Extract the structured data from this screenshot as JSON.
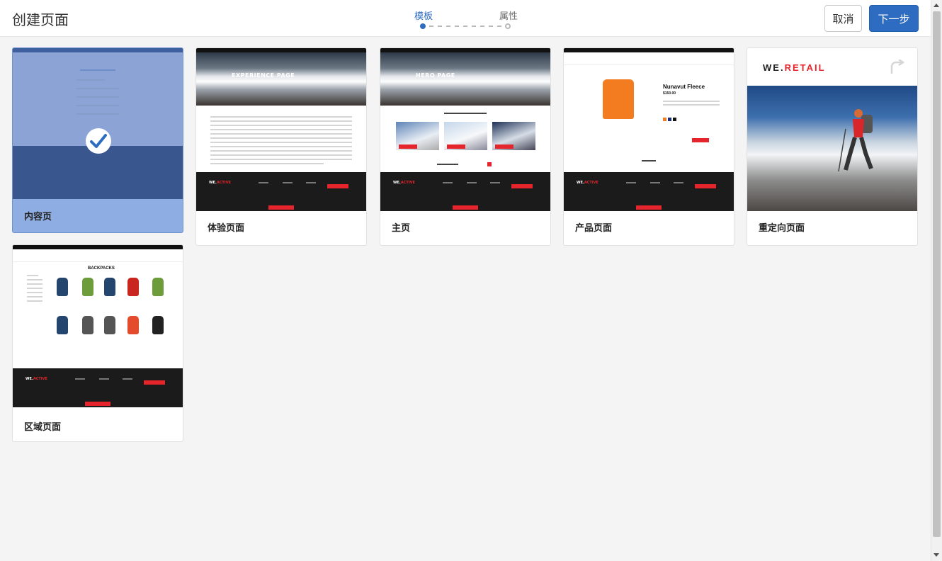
{
  "header": {
    "title": "创建页面",
    "steps": [
      {
        "label": "模板",
        "active": true
      },
      {
        "label": "属性",
        "active": false
      }
    ],
    "cancel_label": "取消",
    "next_label": "下一步"
  },
  "colors": {
    "accent": "#2d6cc0",
    "selected_card": "#8eaee3",
    "brand_red": "#e5242c",
    "footer_dark": "#1b1b1b"
  },
  "templates": [
    {
      "label": "内容页",
      "selected": true
    },
    {
      "label": "体验页面",
      "selected": false
    },
    {
      "label": "主页",
      "selected": false
    },
    {
      "label": "产品页面",
      "selected": false
    },
    {
      "label": "重定向页面",
      "selected": false
    },
    {
      "label": "区域页面",
      "selected": false
    }
  ],
  "thumbnails": {
    "experience_hero": "EXPERIENCE PAGE",
    "home_hero": "HERO PAGE",
    "product_title": "Nunavut Fleece",
    "product_price": "$150.00",
    "redirect_logo_prefix": "WE.",
    "redirect_logo_suffix": "RETAIL",
    "area_title": "BACKPACKS",
    "footer_logo_prefix": "WE.",
    "footer_logo_suffix": "ACTIVE"
  },
  "icons": {
    "check": "check-icon",
    "redirect": "redirect-arrow-icon"
  }
}
